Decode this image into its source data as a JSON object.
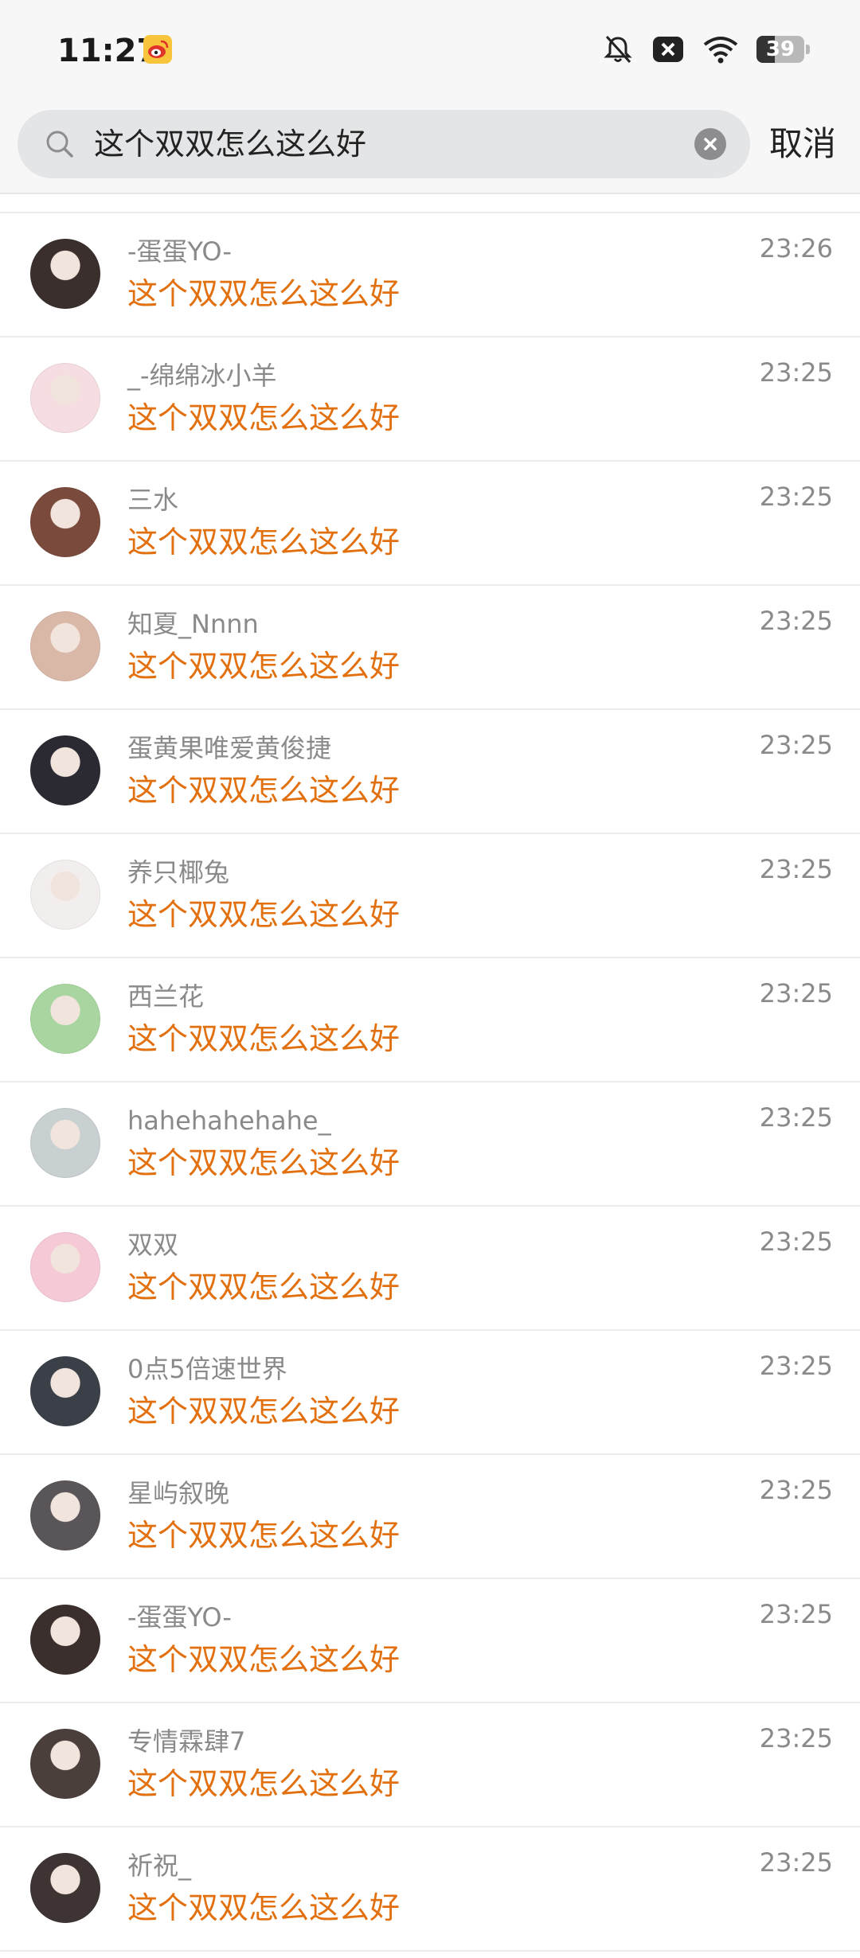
{
  "status_bar": {
    "time": "11:27",
    "battery": "39",
    "battery_level": 0.39,
    "icons": [
      "weibo-app-icon",
      "bell-off-icon",
      "close-box-icon",
      "wifi-icon",
      "battery-icon"
    ]
  },
  "search": {
    "query": "这个双双怎么这么好",
    "cancel_label": "取消"
  },
  "results": [
    {
      "name": "-蛋蛋YO-",
      "message": "这个双双怎么这么好",
      "time": "23:26",
      "avatar_color": "#3a2f2c"
    },
    {
      "name": "_-绵绵冰小羊",
      "message": "这个双双怎么这么好",
      "time": "23:25",
      "avatar_color": "#f6dde1"
    },
    {
      "name": "三水",
      "message": "这个双双怎么这么好",
      "time": "23:25",
      "avatar_color": "#7a4a3c"
    },
    {
      "name": "知夏_Nnnn",
      "message": "这个双双怎么这么好",
      "time": "23:25",
      "avatar_color": "#d9b8a8"
    },
    {
      "name": "蛋黄果唯爱黄俊捷",
      "message": "这个双双怎么这么好",
      "time": "23:25",
      "avatar_color": "#2b2a33"
    },
    {
      "name": "养只椰兔",
      "message": "这个双双怎么这么好",
      "time": "23:25",
      "avatar_color": "#f2eeee"
    },
    {
      "name": "西兰花",
      "message": "这个双双怎么这么好",
      "time": "23:25",
      "avatar_color": "#a9d6a0"
    },
    {
      "name": "hahehahehahe_",
      "message": "这个双双怎么这么好",
      "time": "23:25",
      "avatar_color": "#c9d0d2"
    },
    {
      "name": "双双",
      "message": "这个双双怎么这么好",
      "time": "23:25",
      "avatar_color": "#f5c9d6"
    },
    {
      "name": "0点5倍速世界",
      "message": "这个双双怎么这么好",
      "time": "23:25",
      "avatar_color": "#3b3f47"
    },
    {
      "name": "星屿叙晚",
      "message": "这个双双怎么这么好",
      "time": "23:25",
      "avatar_color": "#5a5558"
    },
    {
      "name": "-蛋蛋YO-",
      "message": "这个双双怎么这么好",
      "time": "23:25",
      "avatar_color": "#3a2f2c"
    },
    {
      "name": "专情霖肆7",
      "message": "这个双双怎么这么好",
      "time": "23:25",
      "avatar_color": "#4b3f3c"
    },
    {
      "name": "祈祝_",
      "message": "这个双双怎么这么好",
      "time": "23:25",
      "avatar_color": "#3d3433"
    }
  ],
  "colors": {
    "highlight": "#e2700f",
    "secondary_text": "#8a8a8a",
    "divider": "#ececec"
  }
}
